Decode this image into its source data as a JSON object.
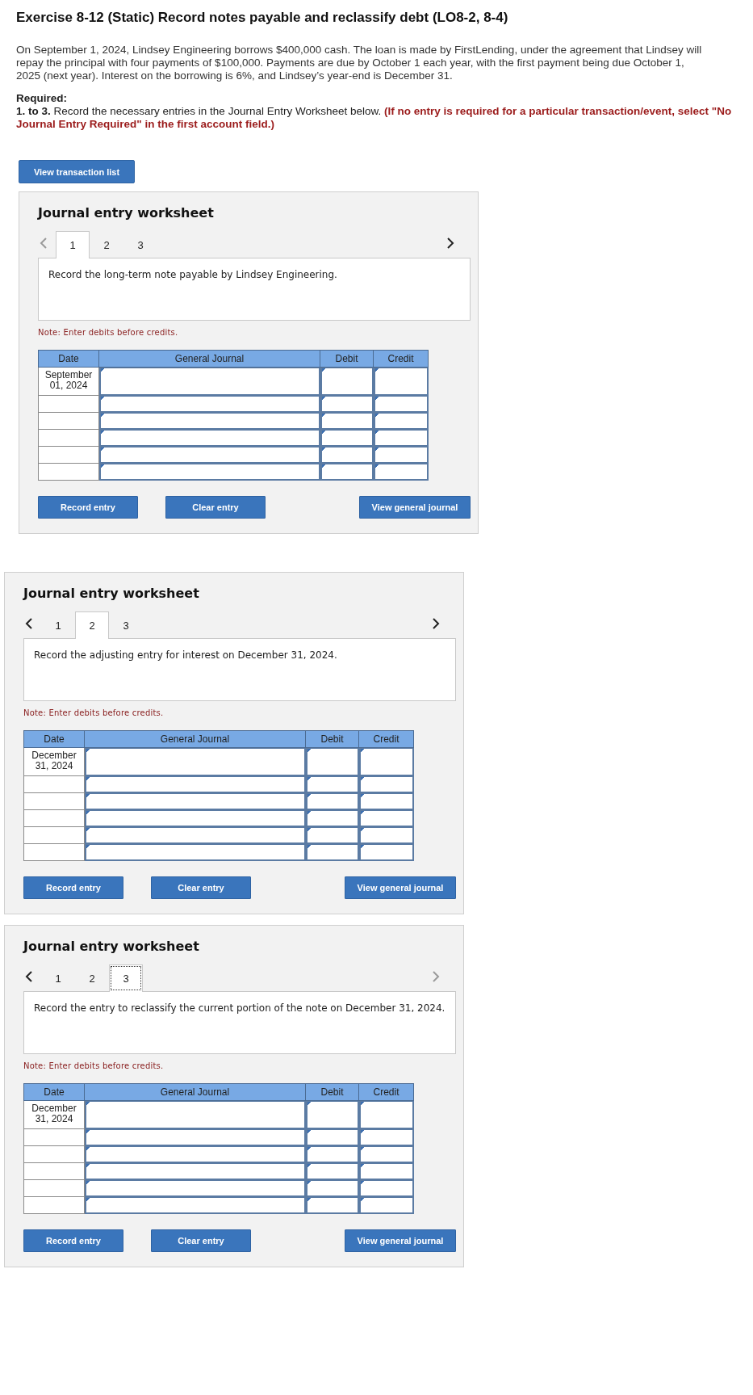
{
  "exercise": {
    "title": "Exercise 8-12 (Static) Record notes payable and reclassify debt (LO8-2, 8-4)",
    "problem": "On September 1, 2024, Lindsey Engineering borrows $400,000 cash. The loan is made by FirstLending, under the agreement that Lindsey will repay the principal with four payments of $100,000. Payments are due by October 1 each year, with the first payment being due October 1, 2025 (next year). Interest on the borrowing is 6%, and Lindsey’s year-end is December 31.",
    "required_label": "Required:",
    "instruction": "**1. to 3.** Record the necessary entries in the Journal Entry Worksheet below.",
    "warning": "(If no entry is required for a particular transaction/event, select \"No Journal Entry Required\" in the first account field.)",
    "button": "View transaction list"
  },
  "worksheets": [
    {
      "title": "Journal entry worksheet",
      "prev_disabled": true,
      "next_disabled": false,
      "tabs": [
        {
          "label": "1",
          "selected": true,
          "focused": false
        },
        {
          "label": "2",
          "selected": false,
          "focused": false
        },
        {
          "label": "3",
          "selected": false,
          "focused": false
        }
      ],
      "prompt": "Record the long-term note payable by Lindsey Engineering.",
      "note": "Note: Enter debits before credits.",
      "columns": [
        "Date",
        "General Journal",
        "Debit",
        "Credit"
      ],
      "rows": [
        {
          "kind": "dated",
          "date": "September 01, 2024"
        },
        {
          "kind": "blank"
        },
        {
          "kind": "blank"
        },
        {
          "kind": "blank"
        },
        {
          "kind": "blank"
        },
        {
          "kind": "blank"
        }
      ],
      "buttons": [
        "Record entry",
        "Clear entry",
        "View general journal"
      ]
    },
    {
      "title": "Journal entry worksheet",
      "prev_disabled": false,
      "next_disabled": false,
      "tabs": [
        {
          "label": "1",
          "selected": false,
          "focused": false
        },
        {
          "label": "2",
          "selected": true,
          "focused": false
        },
        {
          "label": "3",
          "selected": false,
          "focused": false
        }
      ],
      "prompt": "Record the adjusting entry for interest on December 31, 2024.",
      "note": "Note: Enter debits before credits.",
      "columns": [
        "Date",
        "General Journal",
        "Debit",
        "Credit"
      ],
      "rows": [
        {
          "kind": "dated",
          "date": "December 31, 2024"
        },
        {
          "kind": "blank"
        },
        {
          "kind": "blank"
        },
        {
          "kind": "blank"
        },
        {
          "kind": "blank"
        },
        {
          "kind": "blank"
        }
      ],
      "buttons": [
        "Record entry",
        "Clear entry",
        "View general journal"
      ]
    },
    {
      "title": "Journal entry worksheet",
      "prev_disabled": false,
      "next_disabled": true,
      "tabs": [
        {
          "label": "1",
          "selected": false,
          "focused": false
        },
        {
          "label": "2",
          "selected": false,
          "focused": false
        },
        {
          "label": "3",
          "selected": true,
          "focused": true
        }
      ],
      "prompt": "Record the entry to reclassify the current portion of the note on December 31, 2024.",
      "note": "Note: Enter debits before credits.",
      "columns": [
        "Date",
        "General Journal",
        "Debit",
        "Credit"
      ],
      "rows": [
        {
          "kind": "dated",
          "date": "December 31, 2024"
        },
        {
          "kind": "blank"
        },
        {
          "kind": "blank"
        },
        {
          "kind": "blank"
        },
        {
          "kind": "blank"
        },
        {
          "kind": "blank"
        }
      ],
      "buttons": [
        "Record entry",
        "Clear entry",
        "View general journal"
      ]
    }
  ]
}
